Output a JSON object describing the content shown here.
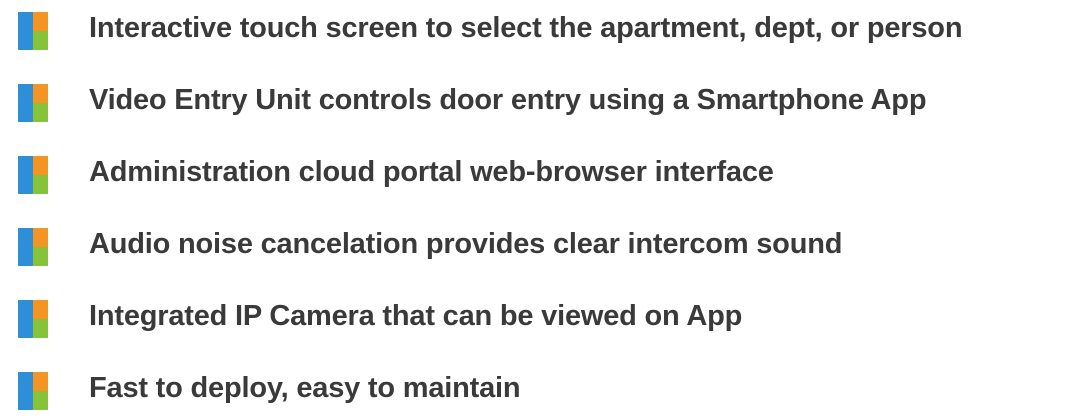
{
  "features": [
    {
      "text": "Interactive touch screen to select the apartment, dept, or person",
      "icon": "color-square-bullet-icon"
    },
    {
      "text": "Video Entry Unit controls door entry using a Smartphone App",
      "icon": "color-square-bullet-icon"
    },
    {
      "text": "Administration cloud portal web-browser interface",
      "icon": "color-square-bullet-icon"
    },
    {
      "text": "Audio noise cancelation provides clear intercom sound",
      "icon": "color-square-bullet-icon"
    },
    {
      "text": "Integrated IP Camera that can be viewed on App",
      "icon": "color-square-bullet-icon"
    },
    {
      "text": "Fast to deploy, easy to maintain",
      "icon": "color-square-bullet-icon"
    }
  ],
  "colors": {
    "text": "#3a3a3a",
    "bullet_blue": "#2f8fd6",
    "bullet_orange": "#f39423",
    "bullet_green": "#86c23a"
  }
}
